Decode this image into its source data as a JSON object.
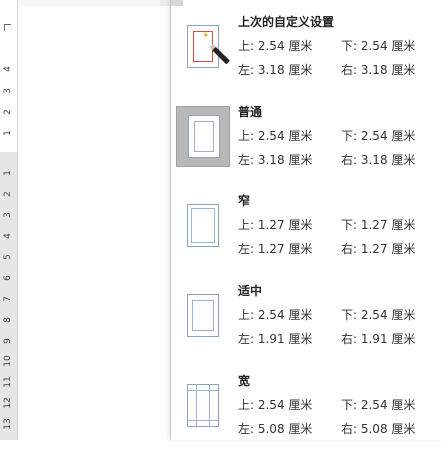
{
  "margins_menu": {
    "presets": [
      {
        "name": "上次的自定义设置",
        "top": "上: 2.54 厘米",
        "bottom": "下: 2.54 厘米",
        "left": "左: 3.18 厘米",
        "right": "右: 3.18 厘米",
        "icon": "custom-margins-icon",
        "selected": false
      },
      {
        "name": "普通",
        "top": "上: 2.54 厘米",
        "bottom": "下: 2.54 厘米",
        "left": "左: 3.18 厘米",
        "right": "右: 3.18 厘米",
        "icon": "normal-margins-icon",
        "selected": true
      },
      {
        "name": "窄",
        "top": "上: 1.27 厘米",
        "bottom": "下: 1.27 厘米",
        "left": "左: 1.27 厘米",
        "right": "右: 1.27 厘米",
        "icon": "narrow-margins-icon",
        "selected": false
      },
      {
        "name": "适中",
        "top": "上: 2.54 厘米",
        "bottom": "下: 2.54 厘米",
        "left": "左: 1.91 厘米",
        "right": "右: 1.91 厘米",
        "icon": "moderate-margins-icon",
        "selected": false
      },
      {
        "name": "宽",
        "top": "上: 2.54 厘米",
        "bottom": "下: 2.54 厘米",
        "left": "左: 5.08 厘米",
        "right": "右: 5.08 厘米",
        "icon": "wide-margins-icon",
        "selected": false
      }
    ]
  },
  "ruler": {
    "upper_numbers": [
      "4",
      "3",
      "2",
      "1"
    ],
    "lower_numbers": [
      "1",
      "2",
      "3",
      "4",
      "5",
      "6",
      "7",
      "8",
      "9",
      "10",
      "11",
      "12",
      "13"
    ]
  },
  "colors": {
    "selected_bg": "#b8b8b8",
    "page_border": "#8aa3c4",
    "custom_margin": "#d94b4b"
  }
}
